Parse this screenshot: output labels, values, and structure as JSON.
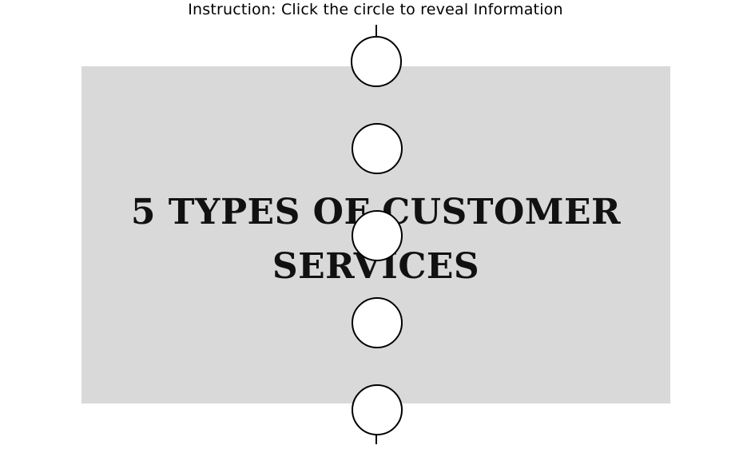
{
  "instruction": {
    "text": "Instruction: Click the circle to reveal Information"
  },
  "slide": {
    "title_line_1": "5 TYPES OF CUSTOMER",
    "title_line_2": "SERVICES",
    "background_color": "#d9d9d9"
  },
  "circles": {
    "count": 5,
    "border_color": "#000000",
    "fill_color": "#ffffff"
  }
}
